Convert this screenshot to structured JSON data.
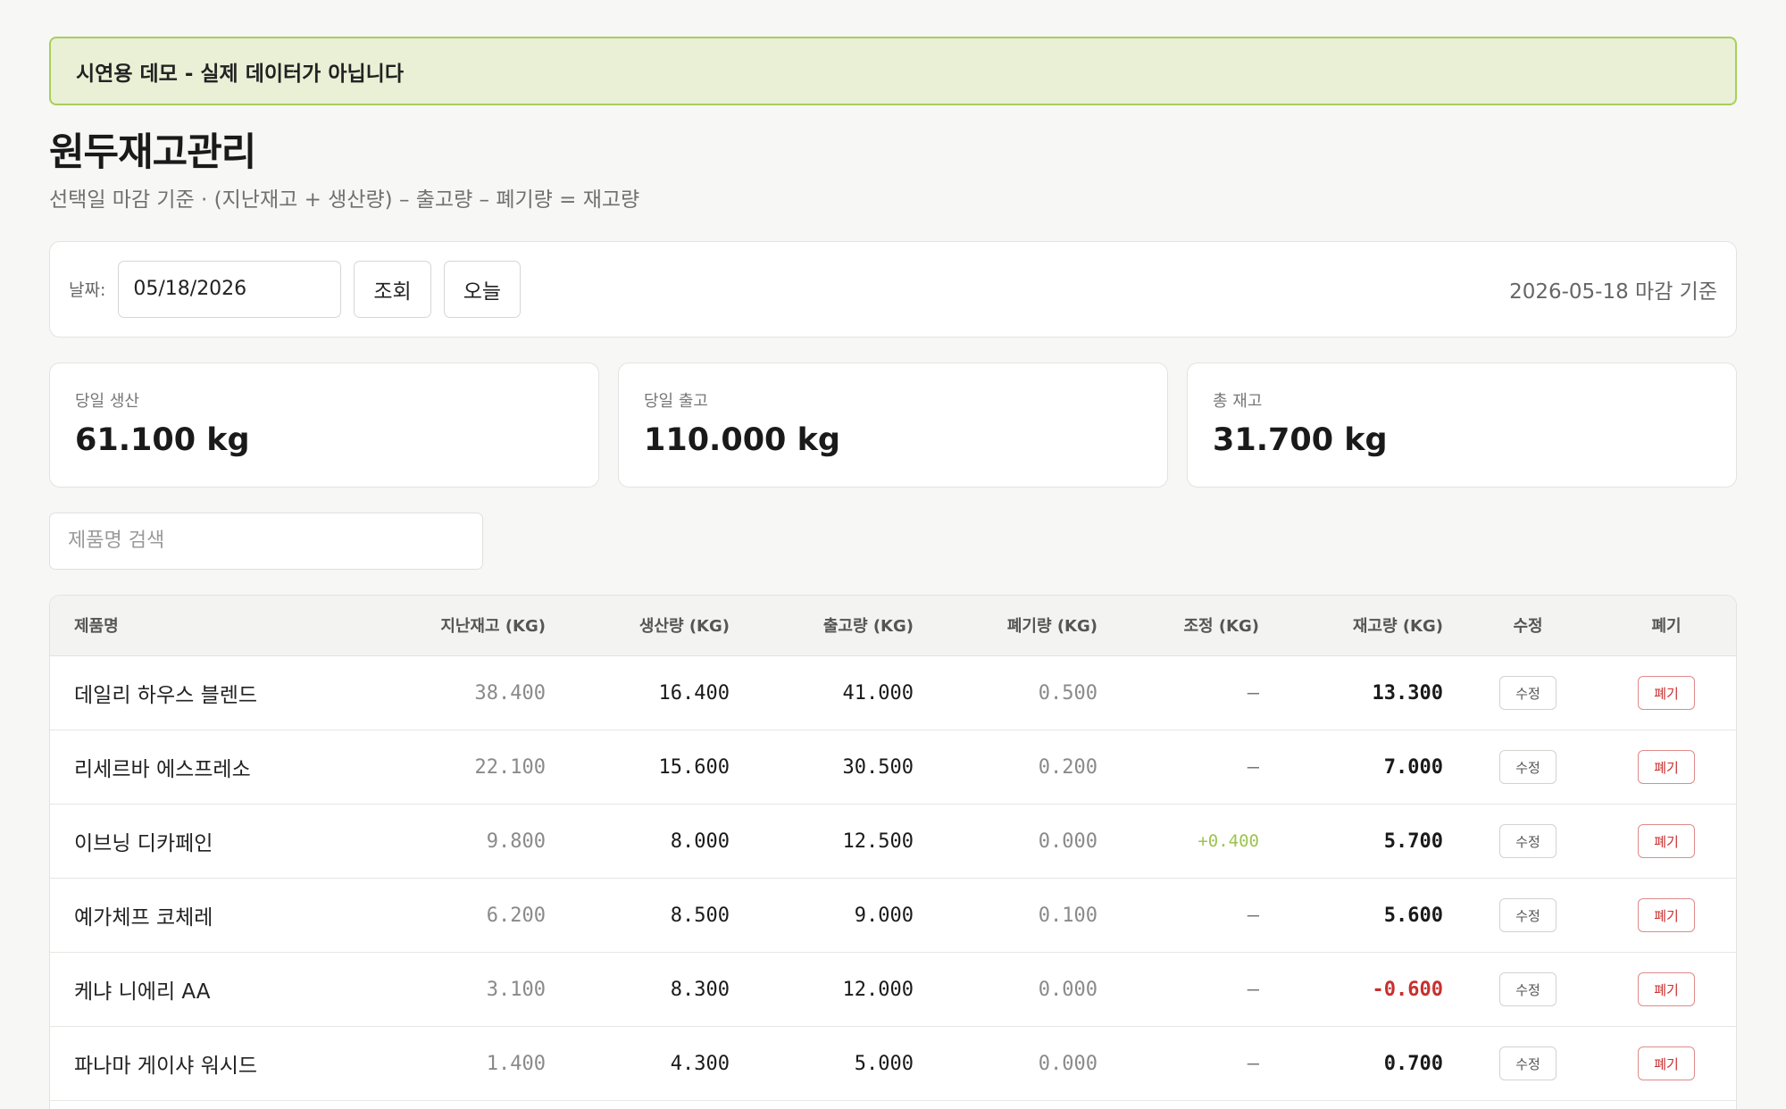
{
  "banner": {
    "text": "시연용 데모 - 실제 데이터가 아닙니다"
  },
  "header": {
    "title": "원두재고관리",
    "subtitle": "선택일 마감 기준 · (지난재고 + 생산량) – 출고량 – 폐기량 = 재고량"
  },
  "toolbar": {
    "date_label": "날짜:",
    "date_value": "05/18/2026",
    "query_label": "조회",
    "today_label": "오늘",
    "basis_text": "2026-05-18 마감 기준"
  },
  "summary": [
    {
      "label": "당일 생산",
      "value": "61.100 kg"
    },
    {
      "label": "당일 출고",
      "value": "110.000 kg"
    },
    {
      "label": "총 재고",
      "value": "31.700 kg"
    }
  ],
  "search": {
    "placeholder": "제품명 검색"
  },
  "table": {
    "columns": [
      "제품명",
      "지난재고 (KG)",
      "생산량 (KG)",
      "출고량 (KG)",
      "폐기량 (KG)",
      "조정 (KG)",
      "재고량 (KG)",
      "수정",
      "폐기"
    ],
    "edit_label": "수정",
    "waste_label": "폐기",
    "rows": [
      {
        "name": "데일리 하우스 블렌드",
        "prev": "38.400",
        "prod": "16.400",
        "out": "41.000",
        "waste": "0.500",
        "adj": "–",
        "stock": "13.300",
        "negative": false,
        "adj_positive": false
      },
      {
        "name": "리세르바 에스프레소",
        "prev": "22.100",
        "prod": "15.600",
        "out": "30.500",
        "waste": "0.200",
        "adj": "–",
        "stock": "7.000",
        "negative": false,
        "adj_positive": false
      },
      {
        "name": "이브닝 디카페인",
        "prev": "9.800",
        "prod": "8.000",
        "out": "12.500",
        "waste": "0.000",
        "adj": "+0.400",
        "stock": "5.700",
        "negative": false,
        "adj_positive": true
      },
      {
        "name": "예가체프 코체레",
        "prev": "6.200",
        "prod": "8.500",
        "out": "9.000",
        "waste": "0.100",
        "adj": "–",
        "stock": "5.600",
        "negative": false,
        "adj_positive": false
      },
      {
        "name": "케냐 니에리 AA",
        "prev": "3.100",
        "prod": "8.300",
        "out": "12.000",
        "waste": "0.000",
        "adj": "–",
        "stock": "-0.600",
        "negative": true,
        "adj_positive": false
      },
      {
        "name": "파나마 게이샤 워시드",
        "prev": "1.400",
        "prod": "4.300",
        "out": "5.000",
        "waste": "0.000",
        "adj": "–",
        "stock": "0.700",
        "negative": false,
        "adj_positive": false
      }
    ]
  },
  "colors": {
    "accent_green": "#a8cf5a",
    "banner_bg": "#e9f0d6",
    "negative_red": "#c8302e",
    "positive_green": "#9dc34e"
  }
}
